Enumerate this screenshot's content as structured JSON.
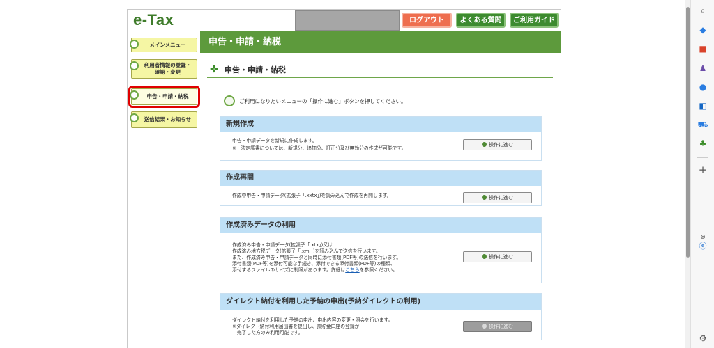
{
  "header": {
    "logo": "e-Tax",
    "logout_label": "ログアウト",
    "faq_label": "よくある質問",
    "guide_label": "ご利用ガイド"
  },
  "nav": {
    "items": [
      {
        "label": "メインメニュー"
      },
      {
        "label": "利用者情報の登録・確認・変更"
      },
      {
        "label": "申告・申請・納税"
      },
      {
        "label": "送信結果・お知らせ"
      }
    ]
  },
  "main": {
    "title": "申告・申請・納税",
    "subtitle": "申告・申請・納税",
    "instruction": "ご利用になりたいメニューの「操作に進む」ボタンを押してください。",
    "sections": [
      {
        "heading": "新規作成",
        "lines": [
          "申告・申請データを新規に作成します。",
          "※　法定調書については、新規分、追加分、訂正分及び無効分の作成が可能です。"
        ],
        "button": "操作に進む"
      },
      {
        "heading": "作成再開",
        "lines": [
          "作成中申告・申請データ(拡張子「.xxtx」)を読み込んで作成を再開します。"
        ],
        "button": "操作に進む"
      },
      {
        "heading": "作成済みデータの利用",
        "lines": [
          "作成済み申告・申請データ(拡張子「.xtx」)又は",
          "作成済み地方税データ(拡張子「.xml」)を読み込んで送信を行います。",
          "また、作成済み申告・申請データと同時に添付書類(PDF等)の送信を行います。",
          "添付書類(PDF等)を添付可能な手続き、添付できる添付書類(PDF等)の種類、",
          "添付するファイルのサイズに制限があります。詳細は"
        ],
        "link": "こちら",
        "link_after": "を参照ください。",
        "button": "操作に進む"
      },
      {
        "heading": "ダイレクト納付を利用した予納の申出(予納ダイレクトの利用)",
        "lines": [
          "ダイレクト納付を利用した予納の申出、申出内容の変更・照会を行います。",
          "※ダイレクト納付利用届出書を提出し、預貯金口座の登録が",
          "　完了した方のみ利用可能です。"
        ],
        "button": "操作に進む"
      }
    ]
  }
}
